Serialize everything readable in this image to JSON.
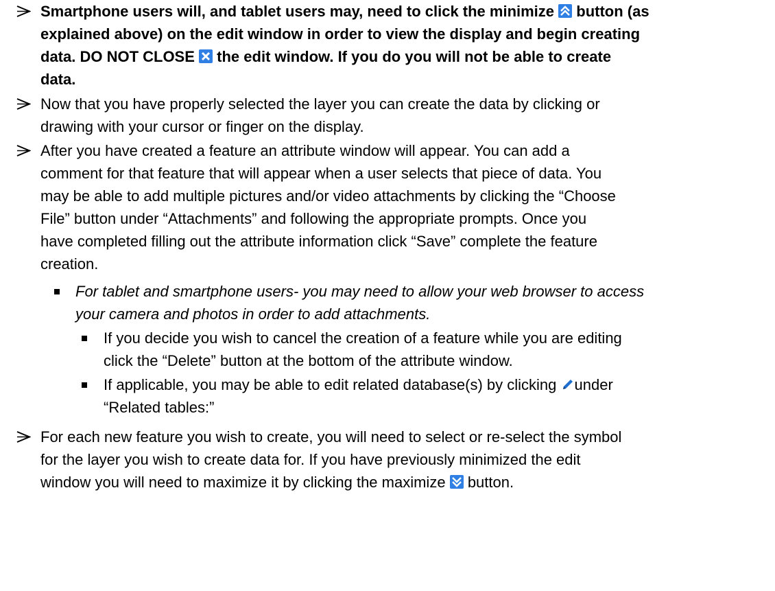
{
  "colors": {
    "icon_blue": "#2f7fe4",
    "icon_red_x_bg": "#2f7fe4",
    "pencil": "#1f6fd0"
  },
  "items": [
    {
      "icons": [
        "minimize-icon",
        "close-icon"
      ],
      "lines": [
        "Smartphone users will, and tablet users may, need to click the minimize",
        "button (as",
        "explained above) on the edit window in order to view the display and begin creating",
        "data.  DO NOT CLOSE",
        "the edit window.  If you do you will not be able to create",
        "data."
      ]
    },
    {
      "lines": [
        "Now that you have properly selected the layer you can create the data by clicking or",
        "drawing with your cursor or finger on the display."
      ]
    },
    {
      "lines": [
        "After you have created a feature an attribute window will appear.  You can add a",
        "comment for that feature that will appear when a user selects that piece of data.  You",
        "may be able to add multiple pictures and/or video attachments by clicking the “Choose",
        "File” button under “Attachments” and following the appropriate prompts.  Once you",
        "have completed filling out the attribute information click “Save” complete the feature",
        "creation."
      ]
    },
    {
      "lines": [
        "For tablet and smartphone users- you may need to allow your web browser to access",
        "your camera and photos in order to add attachments."
      ]
    },
    {
      "lines": [
        "If you decide you wish to cancel the creation of a feature while you are editing",
        "click the “Delete” button at the bottom of the attribute window."
      ]
    },
    {
      "icons": [
        "pencil-icon"
      ],
      "lines": [
        "If applicable, you may be able to edit related database(s) by clicking",
        "under",
        "“Related tables:”"
      ]
    },
    {
      "icons": [
        "maximize-icon"
      ],
      "lines": [
        "For each new feature you wish to create, you will need to select or re-select the symbol",
        "for the layer you wish to create data for.  If you have previously minimized the edit",
        "window you will need to maximize it by clicking the maximize",
        "button."
      ]
    }
  ]
}
